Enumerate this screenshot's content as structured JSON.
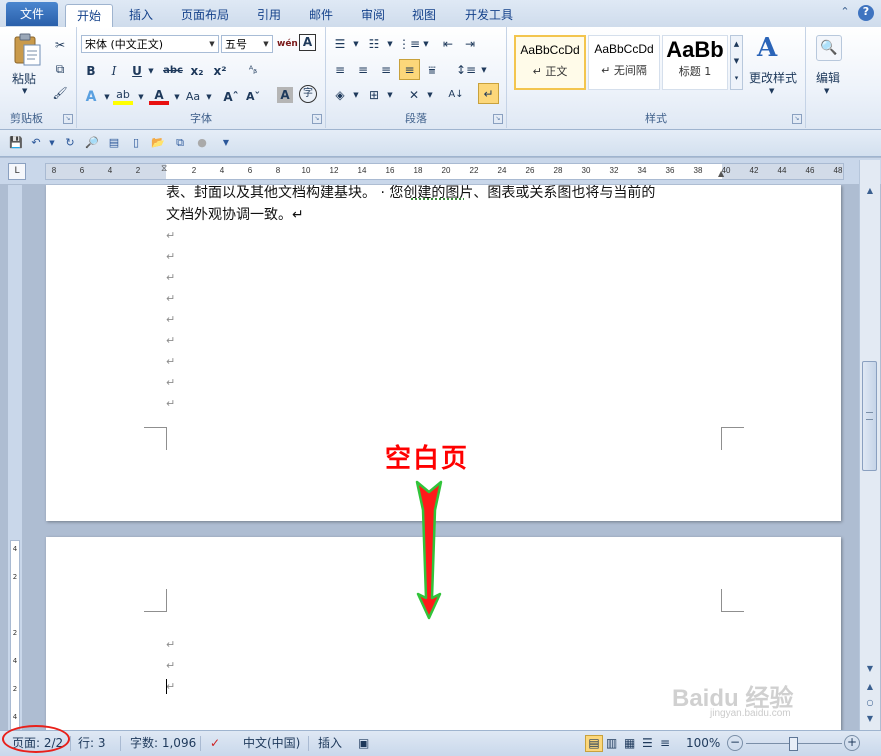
{
  "tabs": [
    {
      "label": "文件"
    },
    {
      "label": "开始"
    },
    {
      "label": "插入"
    },
    {
      "label": "页面布局"
    },
    {
      "label": "引用"
    },
    {
      "label": "邮件"
    },
    {
      "label": "审阅"
    },
    {
      "label": "视图"
    },
    {
      "label": "开发工具"
    }
  ],
  "ribbon": {
    "clipboard": {
      "paste_label": "粘贴",
      "group_label": "剪贴板"
    },
    "font": {
      "font_name": "宋体 (中文正文)",
      "font_size": "五号",
      "group_label": "字体"
    },
    "paragraph": {
      "group_label": "段落"
    },
    "styles": {
      "group_label": "样式",
      "items": [
        {
          "sample": "AaBbCcDd",
          "name": "↵ 正文"
        },
        {
          "sample": "AaBbCcDd",
          "name": "↵ 无间隔"
        },
        {
          "sample": "AaBb",
          "name": "标题 1"
        }
      ],
      "change_styles": "更改样式"
    },
    "editing": {
      "label": "编辑"
    }
  },
  "ruler": {
    "h_ticks": [
      "8",
      "6",
      "4",
      "2",
      "",
      "2",
      "4",
      "6",
      "8",
      "10",
      "12",
      "14",
      "16",
      "18",
      "20",
      "22",
      "24",
      "26",
      "28",
      "30",
      "32",
      "34",
      "36",
      "38",
      "40",
      "42",
      "44",
      "46",
      "48"
    ],
    "v_ticks": [
      "4",
      "2",
      "",
      "2",
      "4",
      "2",
      "4"
    ]
  },
  "document": {
    "lines": [
      "表、封面以及其他文档构建基块。 · 您创建的图片、图表或关系图也将与当前的",
      "文档外观协调一致。↵"
    ],
    "para_mark": "↵"
  },
  "annotation": {
    "blank_page_label": "空白页"
  },
  "status": {
    "page": "页面: 2/2",
    "line": "行: 3",
    "words": "字数: 1,096",
    "language": "中文(中国)",
    "mode": "插入",
    "zoom": "100%"
  },
  "watermark": {
    "text": "Baidu 经验",
    "url": "jingyan.baidu.com"
  }
}
